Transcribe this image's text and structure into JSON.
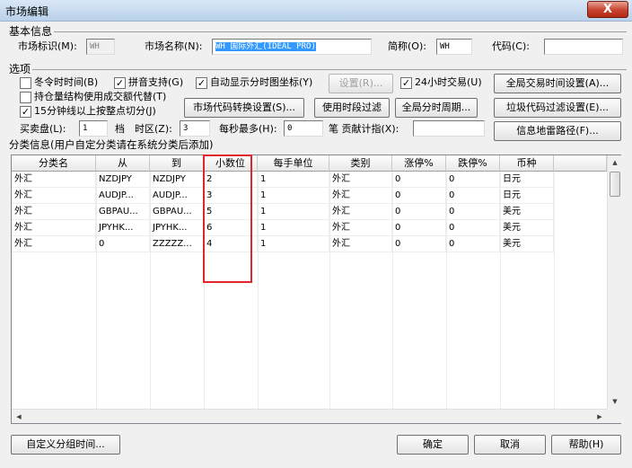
{
  "window": {
    "title": "市场编辑",
    "close_label": "X"
  },
  "basic_group": {
    "label": "基本信息"
  },
  "basic": {
    "market_id_label": "市场标识(M):",
    "market_id_value": "WH",
    "market_name_label": "市场名称(N):",
    "market_name_value": "WH 国际外汇(IDEAL PRO)",
    "short_label": "简称(O):",
    "short_value": "WH",
    "code_label": "代码(C):",
    "code_value": ""
  },
  "options_group": {
    "label": "选项"
  },
  "options": {
    "dst": {
      "label": "冬令时时间(B)",
      "checked": false
    },
    "pinyin": {
      "label": "拼音支持(G)",
      "checked": true
    },
    "auto_coords": {
      "label": "自动显示分时图坐标(Y)",
      "checked": true
    },
    "settings_btn": "设置(R)...",
    "trade24": {
      "label": "24小时交易(U)",
      "checked": true
    },
    "global_time_btn": "全局交易时间设置(A)...",
    "hold_struct": {
      "label": "持仓量结构使用成交额代替(T)",
      "checked": false
    },
    "cut15": {
      "label": "15分钟线以上按整点切分(J)",
      "checked": true
    },
    "code_convert_btn": "市场代码转换设置(S)...",
    "period_filter_btn": "使用时段过滤",
    "global_period_btn": "全局分时周期...",
    "junk_filter_btn": "垃圾代码过滤设置(E)...",
    "bidask_label": "买卖盘(L):",
    "bidask_value": "1",
    "levels_label": "档",
    "timezone_label": "时区(Z):",
    "timezone_value": "3",
    "max_per_sec_label": "每秒最多(H):",
    "max_per_sec_value": "0",
    "contrib_label": "笔  贡献计指(X):",
    "contrib_value": "",
    "info_path_btn": "信息地雷路径(F)..."
  },
  "category_section": {
    "label": "分类信息(用户自定分类请在系统分类后添加)"
  },
  "table": {
    "headers": [
      "分类名",
      "从",
      "到",
      "小数位",
      "每手单位",
      "类别",
      "涨停%",
      "跌停%",
      "币种"
    ],
    "rows": [
      [
        "外汇",
        "NZDJPY",
        "NZDJPY",
        "2",
        "1",
        "外汇",
        "0",
        "0",
        "日元"
      ],
      [
        "外汇",
        "AUDJP...",
        "AUDJP...",
        "3",
        "1",
        "外汇",
        "0",
        "0",
        "日元"
      ],
      [
        "外汇",
        "GBPAU...",
        "GBPAU...",
        "5",
        "1",
        "外汇",
        "0",
        "0",
        "美元"
      ],
      [
        "外汇",
        "JPYHK...",
        "JPYHK...",
        "6",
        "1",
        "外汇",
        "0",
        "0",
        "美元"
      ],
      [
        "外汇",
        "0",
        "ZZZZZ...",
        "4",
        "1",
        "外汇",
        "0",
        "0",
        "美元"
      ]
    ]
  },
  "scroll": {
    "up": "▲",
    "down": "▼",
    "left": "◀",
    "right": "▶"
  },
  "footer": {
    "custom_group_time_btn": "自定义分组时间...",
    "ok_btn": "确定",
    "cancel_btn": "取消",
    "help_btn": "帮助(H)"
  },
  "colors": {
    "highlight_box": "#e0262a",
    "selection": "#3399ff"
  }
}
